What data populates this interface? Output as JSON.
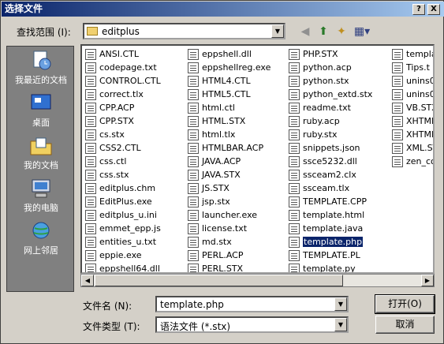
{
  "window": {
    "title": "选择文件",
    "help_label": "?",
    "close_label": "X"
  },
  "lookin": {
    "label": "查找范围 (I):",
    "value": "editplus"
  },
  "toolbar": {
    "back_icon": "back-arrow-icon",
    "up_icon": "up-folder-icon",
    "newfolder_icon": "new-folder-icon",
    "view_icon": "view-menu-icon"
  },
  "places": [
    {
      "label": "我最近的文档",
      "icon": "recent-documents-icon"
    },
    {
      "label": "桌面",
      "icon": "desktop-icon"
    },
    {
      "label": "我的文档",
      "icon": "my-documents-icon"
    },
    {
      "label": "我的电脑",
      "icon": "my-computer-icon"
    },
    {
      "label": "网上邻居",
      "icon": "network-places-icon"
    }
  ],
  "files": {
    "col1": [
      "ANSI.CTL",
      "codepage.txt",
      "CONTROL.CTL",
      "correct.tlx",
      "CPP.ACP",
      "CPP.STX",
      "cs.stx",
      "CSS2.CTL",
      "css.ctl",
      "css.stx",
      "editplus.chm",
      "EditPlus.exe",
      "editplus_u.ini",
      "emmet_epp.js",
      "entities_u.txt",
      "eppie.exe",
      "eppshell64.dll"
    ],
    "col2": [
      "eppshell.dll",
      "eppshellreg.exe",
      "HTML4.CTL",
      "HTML5.CTL",
      "html.ctl",
      "HTML.STX",
      "html.tlx",
      "HTMLBAR.ACP",
      "JAVA.ACP",
      "JAVA.STX",
      "JS.STX",
      "jsp.stx",
      "launcher.exe",
      "license.txt",
      "md.stx",
      "PERL.ACP",
      "PERL.STX"
    ],
    "col3": [
      "PHP.STX",
      "python.acp",
      "python.stx",
      "python_extd.stx",
      "readme.txt",
      "ruby.acp",
      "ruby.stx",
      "snippets.json",
      "ssce5232.dll",
      "ssceam2.clx",
      "ssceam.tlx",
      "TEMPLATE.CPP",
      "template.html",
      "template.java",
      "template.php",
      "TEMPLATE.PL",
      "template.py"
    ],
    "col4": [
      "templa",
      "Tips.t",
      "unins0",
      "unins0",
      "VB.STX",
      "XHTML.",
      "XHTMLB",
      "XML.ST",
      "zen_co"
    ],
    "selected": "template.php"
  },
  "filename": {
    "label": "文件名 (N):",
    "value": "template.php"
  },
  "filetype": {
    "label": "文件类型 (T):",
    "value": "语法文件 (*.stx)"
  },
  "buttons": {
    "open": "打开(O)",
    "cancel": "取消"
  }
}
